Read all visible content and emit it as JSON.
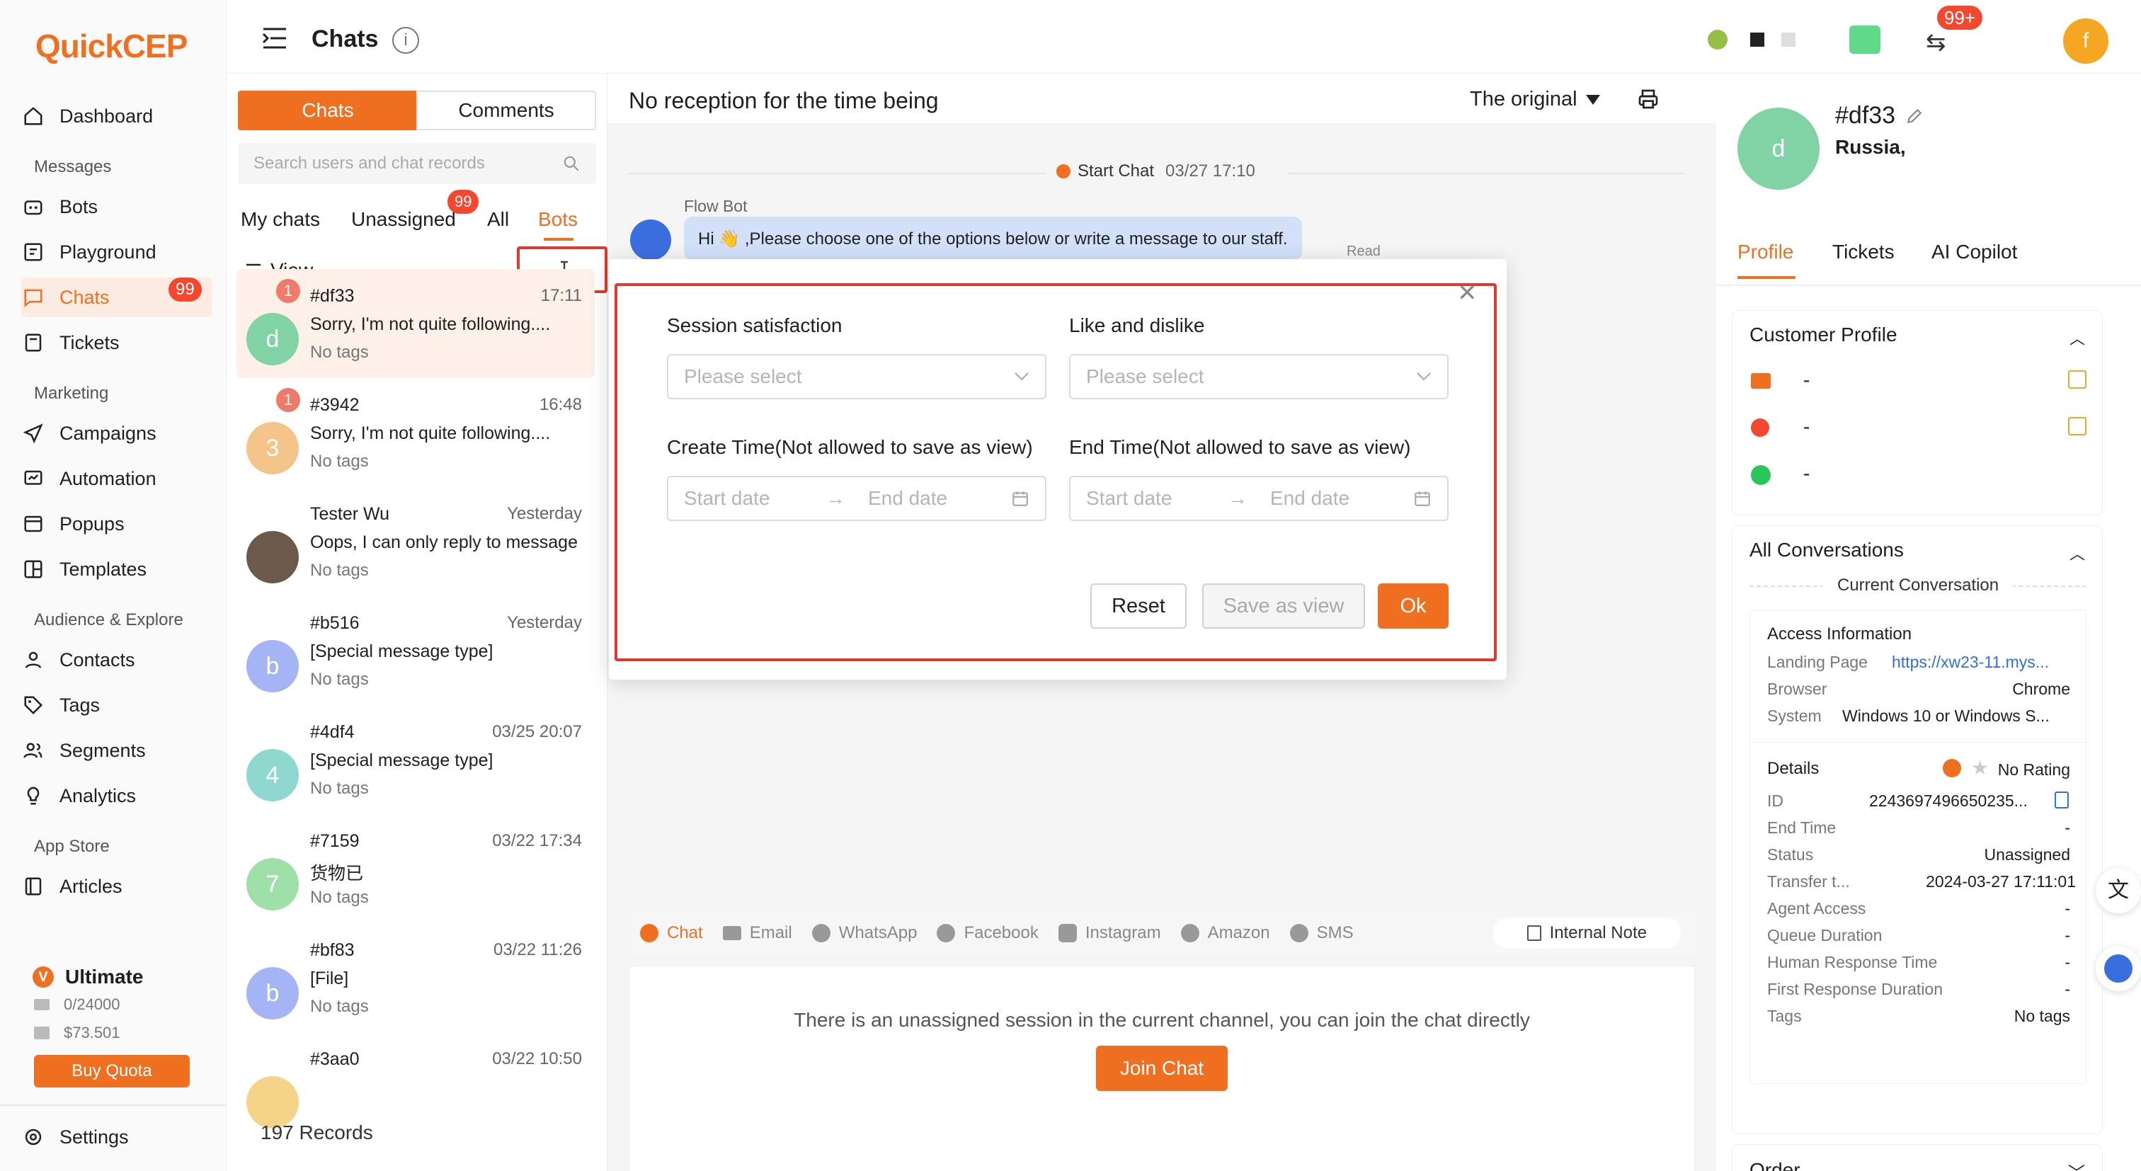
{
  "app": {
    "brand": "QuickCEP",
    "accent": "#f07022"
  },
  "nav": {
    "dashboard": "Dashboard",
    "group_messages": "Messages",
    "bots": "Bots",
    "playground": "Playground",
    "chats": "Chats",
    "chats_badge": "99",
    "tickets": "Tickets",
    "group_marketing": "Marketing",
    "campaigns": "Campaigns",
    "automation": "Automation",
    "popups": "Popups",
    "templates": "Templates",
    "group_audience": "Audience & Explore",
    "contacts": "Contacts",
    "tags": "Tags",
    "segments": "Segments",
    "analytics": "Analytics",
    "group_appstore": "App Store",
    "articles": "Articles",
    "plan": "Ultimate",
    "quota_messages": "0/24000",
    "quota_money": "$73.501",
    "buy_quota": "Buy Quota",
    "settings": "Settings"
  },
  "topbar": {
    "title": "Chats",
    "notify_badge": "99+",
    "user_initial": "f"
  },
  "list": {
    "tab_chats": "Chats",
    "tab_comments": "Comments",
    "search_placeholder": "Search users and chat records",
    "filter_my": "My chats",
    "filter_unassigned": "Unassigned",
    "unassigned_badge": "99",
    "filter_all": "All",
    "filter_bots": "Bots",
    "view_label": "View",
    "records": "197 Records",
    "rows": [
      {
        "name": "#df33",
        "time": "17:11",
        "msg": "Sorry, I'm not quite following....",
        "tags": "No tags",
        "initial": "d",
        "badge": "1",
        "color": "#7fd3a5"
      },
      {
        "name": "#3942",
        "time": "16:48",
        "msg": "Sorry, I'm not quite following....",
        "tags": "No tags",
        "initial": "3",
        "badge": "1",
        "color": "#f5c48a"
      },
      {
        "name": "Tester Wu",
        "time": "Yesterday",
        "msg": "Oops, I can only reply to message",
        "tags": "No tags",
        "initial": "",
        "badge": "",
        "color": "#6b5a4a"
      },
      {
        "name": "#b516",
        "time": "Yesterday",
        "msg": "[Special message type]",
        "tags": "No tags",
        "initial": "b",
        "badge": "",
        "color": "#a5b4f5"
      },
      {
        "name": "#4df4",
        "time": "03/25 20:07",
        "msg": "[Special message type]",
        "tags": "No tags",
        "initial": "4",
        "badge": "",
        "color": "#8ed8d0"
      },
      {
        "name": "#7159",
        "time": "03/22 17:34",
        "msg": "货物已",
        "tags": "No tags",
        "initial": "7",
        "badge": "",
        "color": "#9ee0a8"
      },
      {
        "name": "#bf83",
        "time": "03/22 11:26",
        "msg": "[File]",
        "tags": "No tags",
        "initial": "b",
        "badge": "",
        "color": "#a5b4f5"
      },
      {
        "name": "#3aa0",
        "time": "03/22 10:50",
        "msg": "",
        "tags": "",
        "initial": "",
        "badge": "",
        "color": "#f5d48a"
      }
    ]
  },
  "conv": {
    "status": "No reception for the time being",
    "lang": "The original",
    "start_chat": "Start Chat",
    "start_time": "03/27 17:10",
    "bot_name": "Flow Bot",
    "bot_msg": "Hi 👋 ,Please choose one of the options below or write a message to our staff.",
    "read": "Read",
    "channels": [
      "Chat",
      "Email",
      "WhatsApp",
      "Facebook",
      "Instagram",
      "Amazon",
      "SMS"
    ],
    "internal_note": "Internal Note",
    "unassigned_msg": "There is an unassigned session in the current channel, you can join the chat directly",
    "join_chat": "Join Chat"
  },
  "modal": {
    "session_label": "Session satisfaction",
    "like_label": "Like and dislike",
    "please_select": "Please select",
    "create_label": "Create Time(Not allowed to save as view)",
    "end_label": "End Time(Not allowed to save as view)",
    "start_date": "Start date",
    "end_date": "End date",
    "reset": "Reset",
    "save_view": "Save as view",
    "ok": "Ok"
  },
  "right": {
    "name": "#df33",
    "location": "Russia,",
    "initial": "d",
    "tab_profile": "Profile",
    "tab_tickets": "Tickets",
    "tab_copilot": "AI Copilot",
    "customer_profile": "Customer Profile",
    "dash": "-",
    "all_conversations": "All Conversations",
    "current_conversation": "Current Conversation",
    "access_info": "Access Information",
    "landing_label": "Landing Page",
    "landing_value": "https://xw23-11.mys...",
    "browser_label": "Browser",
    "browser_value": "Chrome",
    "system_label": "System",
    "system_value": "Windows 10 or Windows S...",
    "details": "Details",
    "no_rating": "No Rating",
    "id_label": "ID",
    "id_value": "2243697496650235...",
    "end_time_label": "End Time",
    "status_label": "Status",
    "status_value": "Unassigned",
    "transfer_label": "Transfer t...",
    "transfer_value": "2024-03-27 17:11:01",
    "agent_access_label": "Agent Access",
    "queue_label": "Queue Duration",
    "human_label": "Human Response Time",
    "first_label": "First Response Duration",
    "tags_label": "Tags",
    "tags_value": "No tags",
    "order": "Order"
  }
}
